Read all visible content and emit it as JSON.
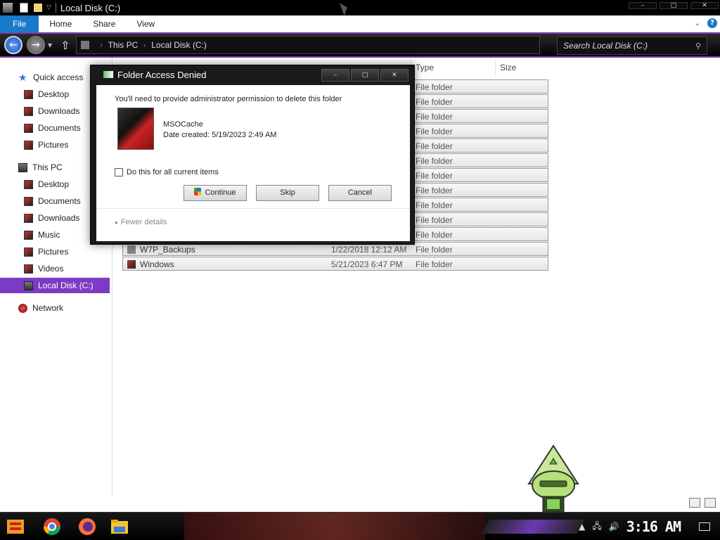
{
  "window": {
    "title": "Local Disk (C:)"
  },
  "ribbon": {
    "tabs": [
      "File",
      "Home",
      "Share",
      "View"
    ]
  },
  "address": {
    "crumbs": [
      "This PC",
      "Local Disk (C:)"
    ],
    "search_placeholder": "Search Local Disk (C:)"
  },
  "sidebar": {
    "items": [
      {
        "label": "Quick access",
        "icon": "star-icon"
      },
      {
        "label": "Desktop",
        "icon": "desktop-icon"
      },
      {
        "label": "Downloads",
        "icon": "downloads-icon"
      },
      {
        "label": "Documents",
        "icon": "documents-icon"
      },
      {
        "label": "Pictures",
        "icon": "pictures-icon"
      },
      {
        "label": "This PC",
        "icon": "pc-icon"
      },
      {
        "label": "Desktop",
        "icon": "desktop-icon"
      },
      {
        "label": "Documents",
        "icon": "documents-icon"
      },
      {
        "label": "Downloads",
        "icon": "downloads-icon"
      },
      {
        "label": "Music",
        "icon": "music-icon"
      },
      {
        "label": "Pictures",
        "icon": "pictures-icon"
      },
      {
        "label": "Videos",
        "icon": "videos-icon"
      },
      {
        "label": "Local Disk (C:)",
        "icon": "drive-icon",
        "selected": true
      },
      {
        "label": "Network",
        "icon": "network-icon"
      }
    ]
  },
  "content": {
    "columns": [
      "Type",
      "Size"
    ],
    "rows": [
      {
        "name": "",
        "date": "",
        "type": "File folder"
      },
      {
        "name": "",
        "date": "",
        "type": "File folder"
      },
      {
        "name": "",
        "date": "",
        "type": "File folder"
      },
      {
        "name": "",
        "date": "",
        "type": "File folder"
      },
      {
        "name": "",
        "date": "",
        "type": "File folder"
      },
      {
        "name": "",
        "date": "",
        "type": "File folder"
      },
      {
        "name": "",
        "date": "",
        "type": "File folder"
      },
      {
        "name": "",
        "date": "",
        "type": "File folder"
      },
      {
        "name": "",
        "date": "",
        "type": "File folder"
      },
      {
        "name": "",
        "date": "",
        "type": "File folder"
      },
      {
        "name": "",
        "date": "",
        "type": "File folder"
      },
      {
        "name": "W7P_Backups",
        "date": "1/22/2018 12:12 AM",
        "type": "File folder"
      },
      {
        "name": "Windows",
        "date": "5/21/2023 6:47 PM",
        "type": "File folder"
      }
    ]
  },
  "dialog": {
    "title": "Folder Access Denied",
    "message": "You'll need to provide administrator permission to delete this folder",
    "folder_name": "MSOCache",
    "date_created": "Date created: 5/19/2023 2:49 AM",
    "checkbox_label": "Do this for all current items",
    "buttons": {
      "continue": "Continue",
      "skip": "Skip",
      "cancel": "Cancel"
    },
    "fewer_details": "Fewer details"
  },
  "taskbar": {
    "clock": "3:16 AM"
  },
  "colors": {
    "accent": "#7b3bc4",
    "file_tab": "#1979ca"
  }
}
